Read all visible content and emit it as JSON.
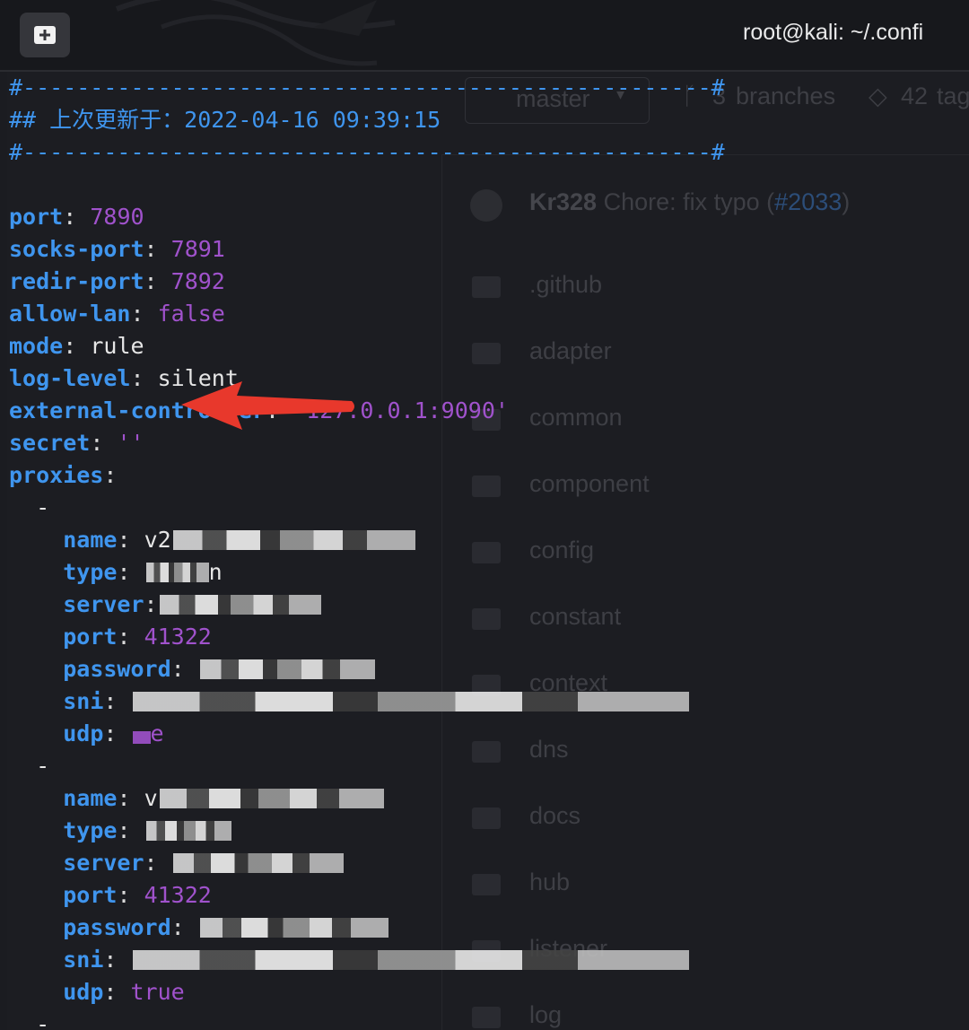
{
  "window": {
    "title": "root@kali: ~/.confi",
    "new_tab_icon": "new-tab-icon",
    "brand_icon": "kali-dragon-icon"
  },
  "background_github": {
    "branch_selector": "master",
    "branches": "3",
    "branches_label": "branches",
    "tags": "42",
    "tags_label": "tag",
    "commit_author": "Kr328",
    "commit_message": "Chore: fix typo (",
    "commit_ref": "#2033",
    "commit_close": ")",
    "folders": [
      ".github",
      "adapter",
      "common",
      "component",
      "config",
      "constant",
      "context",
      "dns",
      "docs",
      "hub",
      "listener",
      "log"
    ]
  },
  "config": {
    "separator_top": "#---------------------------------------------------#",
    "updated_label": "## 上次更新于：2022-04-16 09:39:15",
    "separator_bottom": "#---------------------------------------------------#",
    "port_key": "port",
    "port": "7890",
    "socks_port_key": "socks-port",
    "socks_port": "7891",
    "redir_port_key": "redir-port",
    "redir_port": "7892",
    "allow_lan_key": "allow-lan",
    "allow_lan": "false",
    "mode_key": "mode",
    "mode": "rule",
    "log_level_key": "log-level",
    "log_level": "silent",
    "external_controller_key": "external-controller",
    "external_controller": "'127.0.0.1:9090'",
    "secret_key": "secret",
    "secret": "''",
    "proxies_key": "proxies",
    "list_dash": "-",
    "proxies": [
      {
        "name_key": "name",
        "name": "v2",
        "type_key": "type",
        "type": "",
        "type_tail": "n",
        "server_key": "server",
        "port_key": "port",
        "port": "41322",
        "password_key": "password",
        "sni_key": "sni",
        "udp_key": "udp",
        "udp": "",
        "udp_tail": "e"
      },
      {
        "name_key": "name",
        "name": "v",
        "type_key": "type",
        "server_key": "server",
        "port_key": "port",
        "port": "41322",
        "password_key": "password",
        "sni_key": "sni",
        "udp_key": "udp",
        "udp": "true"
      }
    ],
    "colon": ":"
  },
  "colors": {
    "key": "#3f95ee",
    "value": "#a052cc",
    "plain": "#e6e6e6",
    "arrow": "#e8382c",
    "background": "#1c1d22"
  }
}
